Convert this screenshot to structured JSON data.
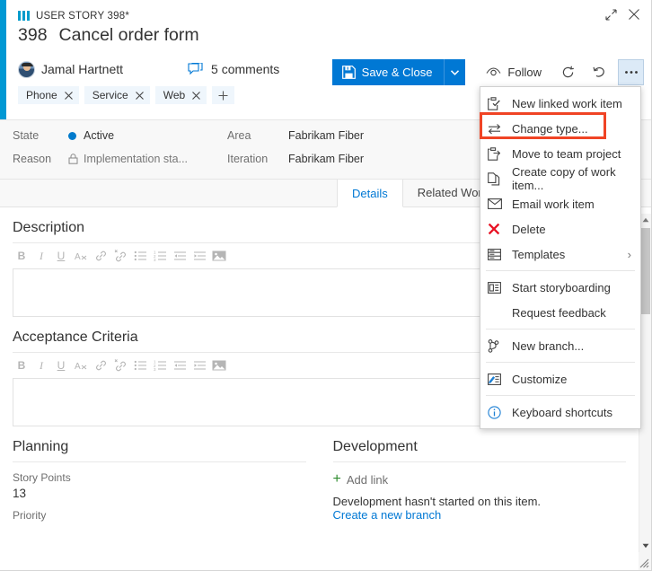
{
  "window": {
    "expand_title": "Expand",
    "close_title": "Close"
  },
  "header": {
    "work_item_type": "USER STORY 398*",
    "id": "398",
    "title": "Cancel order form",
    "assignee": "Jamal Hartnett",
    "comments": "5 comments",
    "tags": [
      "Phone",
      "Service",
      "Web"
    ],
    "add_tag_label": "+"
  },
  "toolbar": {
    "save_label": "Save & Close",
    "save_split_label": "▾",
    "follow_label": "Follow",
    "refresh_title": "Refresh",
    "revert_title": "Revert",
    "more_label": "•••"
  },
  "fields": [
    {
      "name": "State",
      "value": "Active",
      "style": "dot"
    },
    {
      "name": "Reason",
      "value": "Implementation sta...",
      "style": "lock"
    },
    {
      "name": "Area",
      "value": "Fabrikam Fiber",
      "style": "plain"
    },
    {
      "name": "Iteration",
      "value": "Fabrikam Fiber",
      "style": "plain"
    }
  ],
  "tabs": [
    {
      "label": "Details",
      "selected": true
    },
    {
      "label": "Related Work item",
      "selected": false
    }
  ],
  "sections": {
    "description": {
      "title": "Description",
      "content": ""
    },
    "acceptance": {
      "title": "Acceptance Criteria",
      "content": ""
    },
    "planning": {
      "title": "Planning",
      "story_points_label": "Story Points",
      "story_points_value": "13",
      "priority_label": "Priority",
      "priority_value": ""
    },
    "development": {
      "title": "Development",
      "add_link_label": "Add link",
      "status_text": "Development hasn't started on this item.",
      "create_branch_label": "Create a new branch"
    }
  },
  "rte_buttons": [
    {
      "name": "bold",
      "glyph": "B"
    },
    {
      "name": "italic",
      "glyph": "I"
    },
    {
      "name": "underline",
      "glyph": "U"
    },
    {
      "name": "clear-format",
      "glyph": "A"
    },
    {
      "name": "link",
      "glyph": "link"
    },
    {
      "name": "unlink",
      "glyph": "unlink"
    },
    {
      "name": "bullet-list",
      "glyph": "ul"
    },
    {
      "name": "numbered-list",
      "glyph": "ol"
    },
    {
      "name": "outdent",
      "glyph": "outdent"
    },
    {
      "name": "indent",
      "glyph": "indent"
    },
    {
      "name": "image",
      "glyph": "image"
    }
  ],
  "context_menu": [
    {
      "label": "New linked work item",
      "icon": "new-linked-work-item-icon",
      "type": "item"
    },
    {
      "label": "Change type...",
      "icon": "change-type-icon",
      "type": "item",
      "highlighted": true
    },
    {
      "label": "Move to team project",
      "icon": "move-to-team-project-icon",
      "type": "item"
    },
    {
      "label": "Create copy of work item...",
      "icon": "copy-icon",
      "type": "item"
    },
    {
      "label": "Email work item",
      "icon": "email-icon",
      "type": "item"
    },
    {
      "label": "Delete",
      "icon": "delete-icon",
      "type": "item"
    },
    {
      "label": "Templates",
      "icon": "templates-icon",
      "type": "item",
      "submenu": "›"
    },
    {
      "label": "",
      "type": "separator"
    },
    {
      "label": "Start storyboarding",
      "icon": "storyboard-icon",
      "type": "item"
    },
    {
      "label": "Request feedback",
      "icon": "none",
      "type": "item"
    },
    {
      "label": "",
      "type": "separator"
    },
    {
      "label": "New branch...",
      "icon": "branch-icon",
      "type": "item"
    },
    {
      "label": "",
      "type": "separator"
    },
    {
      "label": "Customize",
      "icon": "customize-icon",
      "type": "item"
    },
    {
      "label": "",
      "type": "separator"
    },
    {
      "label": "Keyboard shortcuts",
      "icon": "info-icon",
      "type": "item"
    }
  ],
  "colors": {
    "accent": "#0098d4",
    "primary_button": "#0078d4",
    "link": "#0078d4",
    "highlight_box": "#f04425",
    "state_dot": "#007acc",
    "add_plus": "#2e8b2e",
    "delete_x": "#e81123"
  }
}
